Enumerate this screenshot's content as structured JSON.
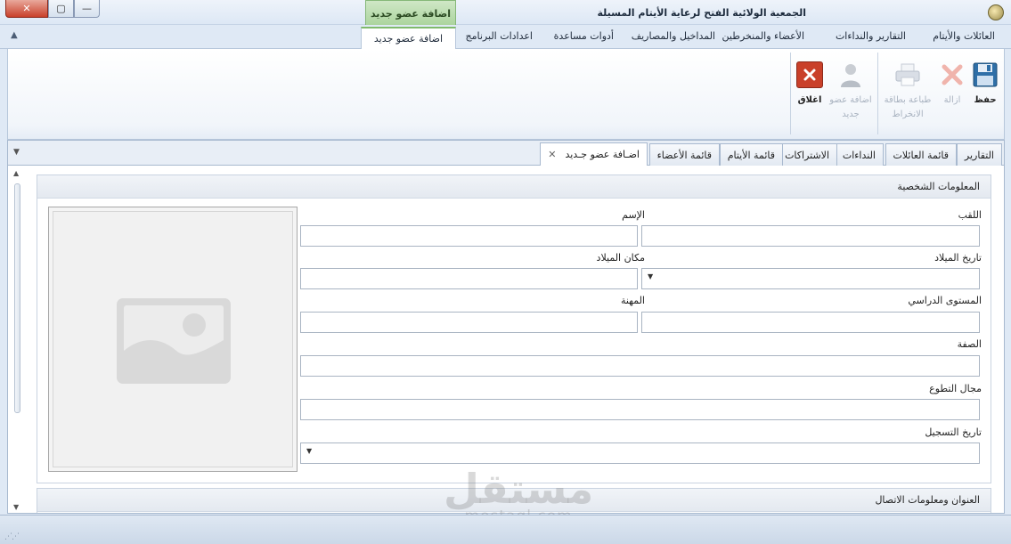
{
  "window": {
    "title": "الجمعية الولائية الفتح لرعاية الأيتام المسيلة",
    "context_tab": "اضافة عضو جديد",
    "controls": {
      "close": "✕",
      "maximize": "▢",
      "minimize": "—"
    }
  },
  "ribbon": {
    "collapse_icon": "chevron-up-icon",
    "tabs": [
      "العائلات والأيتام",
      "التقارير والنداءات",
      "الأعضاء والمنخرطين",
      "المداخيل والمصاريف",
      "أدوات مساعدة",
      "اعدادات البرنامج",
      "اضافة عضو جديد"
    ],
    "active_tab": "اضافة عضو جديد",
    "buttons": {
      "save": "حفظ",
      "delete": "ازالة",
      "print_card": "طباعة بطاقة الانخراط",
      "add_member": "اضافة عضو جديد",
      "close": "اغلاق"
    }
  },
  "doc_tabs": {
    "items": [
      "التقارير",
      "قائمة العائلات",
      "النداءات",
      "الاشتراكات",
      "قائمة الأيتام",
      "قائمة الأعضاء",
      "اضـافة عضو جـديد"
    ],
    "active": "اضـافة عضو جـديد",
    "close_glyph": "✕"
  },
  "personal_info": {
    "header": "المعلومات الشخصية",
    "photo_icon": "image-placeholder-icon",
    "fields": {
      "surname": {
        "label": "اللقب",
        "value": ""
      },
      "name": {
        "label": "الإسم",
        "value": ""
      },
      "birth_date": {
        "label": "تاريخ الميلاد",
        "value": ""
      },
      "birth_place": {
        "label": "مكان الميلاد",
        "value": ""
      },
      "education": {
        "label": "المستوى الدراسي",
        "value": ""
      },
      "job": {
        "label": "المهنة",
        "value": ""
      },
      "role": {
        "label": "الصفة",
        "value": ""
      },
      "volunteer_field": {
        "label": "مجال التطوع",
        "value": ""
      },
      "registration_date": {
        "label": "تاريخ التسجيل",
        "value": ""
      }
    }
  },
  "contact_info": {
    "header": "العنوان ومعلومات الاتصال"
  },
  "watermark": {
    "line1": "مستقل",
    "line2": "mostaql.com"
  },
  "colors": {
    "accent_green": "#7fba6c",
    "close_red": "#c9402a",
    "ribbon_bg": "#dfe9f5"
  }
}
